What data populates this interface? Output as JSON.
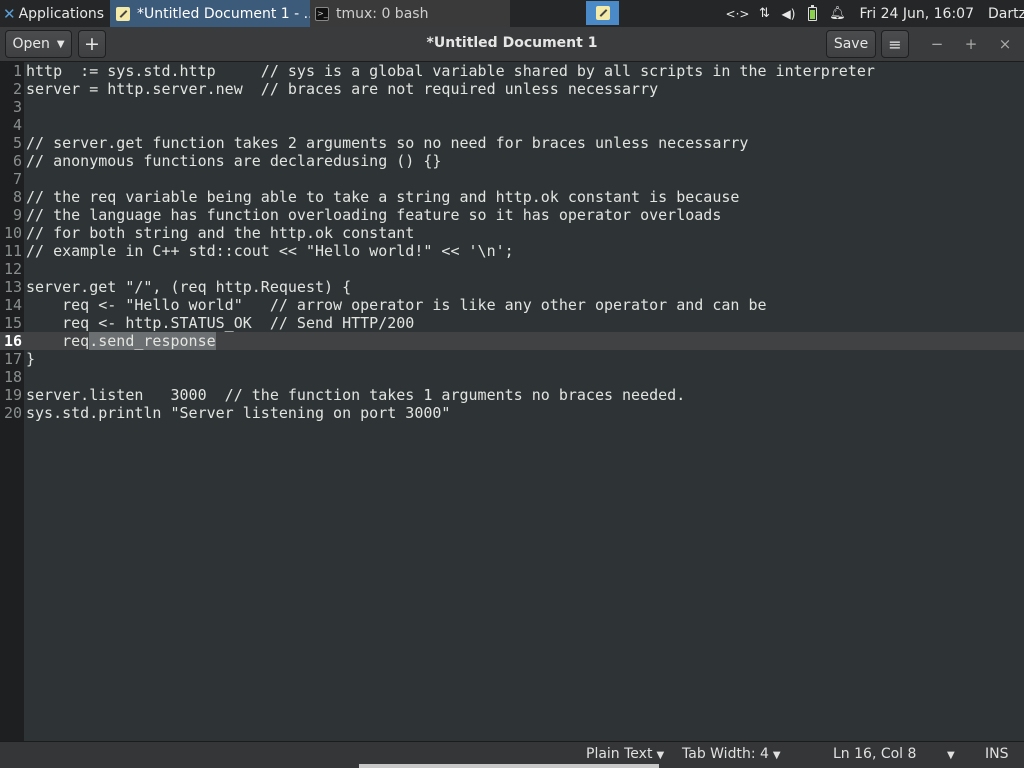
{
  "panel": {
    "apps_label": "Applications",
    "apps_suffix": "☰",
    "tasks": [
      {
        "label": "*Untitled Document 1 - ..."
      },
      {
        "label": "tmux: 0 bash"
      }
    ],
    "tray": {
      "network_icon": "<·>",
      "transfer_icon": "⇅",
      "volume_icon": "🔉",
      "bell_icon": "🔔",
      "clock": "Fri 24 Jun, 16:07",
      "user": "Dartz"
    }
  },
  "header": {
    "open_label": "Open",
    "new_tab_label": "+",
    "title": "*Untitled Document 1",
    "save_label": "Save",
    "menu_icon": "≡",
    "min_icon": "−",
    "max_icon": "+",
    "close_icon": "×"
  },
  "editor": {
    "current_line": 16,
    "lines": [
      {
        "n": "1",
        "text": "http  := sys.std.http     // sys is a global variable shared by all scripts in the interpreter"
      },
      {
        "n": "2",
        "text": "server = http.server.new  // braces are not required unless necessarry"
      },
      {
        "n": "3",
        "text": ""
      },
      {
        "n": "4",
        "text": ""
      },
      {
        "n": "5",
        "text": "// server.get function takes 2 arguments so no need for braces unless necessarry"
      },
      {
        "n": "6",
        "text": "// anonymous functions are declaredusing () {}"
      },
      {
        "n": "7",
        "text": ""
      },
      {
        "n": "8",
        "text": "// the req variable being able to take a string and http.ok constant is because"
      },
      {
        "n": "9",
        "text": "// the language has function overloading feature so it has operator overloads"
      },
      {
        "n": "10",
        "text": "// for both string and the http.ok constant"
      },
      {
        "n": "11",
        "text": "// example in C++ std::cout << \"Hello world!\" << '\\n';"
      },
      {
        "n": "12",
        "text": ""
      },
      {
        "n": "13",
        "text": "server.get \"/\", (req http.Request) {"
      },
      {
        "n": "14",
        "text": "    req <- \"Hello world\"   // arrow operator is like any other operator and can be"
      },
      {
        "n": "15",
        "text": "    req <- http.STATUS_OK  // Send HTTP/200"
      },
      {
        "n": "16",
        "text": "    req",
        "selected": ".send_response"
      },
      {
        "n": "17",
        "text": "}"
      },
      {
        "n": "18",
        "text": ""
      },
      {
        "n": "19",
        "text": "server.listen   3000  // the function takes 1 arguments no braces needed."
      },
      {
        "n": "20",
        "text": "sys.std.println \"Server listening on port 3000\""
      }
    ]
  },
  "status": {
    "language": "Plain Text",
    "tab_width": "Tab Width: 4",
    "position": "Ln 16, Col 8",
    "mode": "INS"
  }
}
